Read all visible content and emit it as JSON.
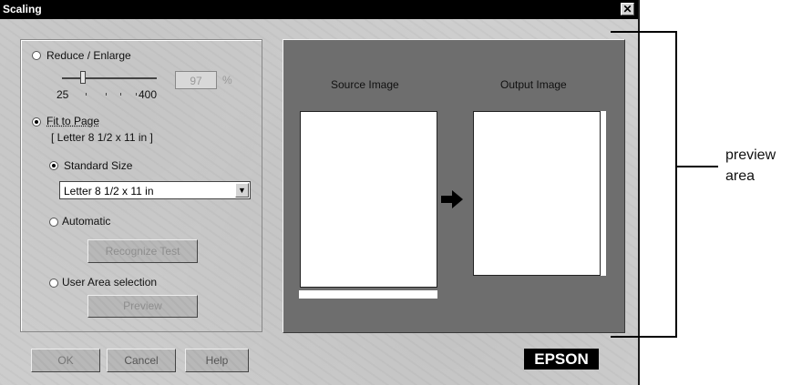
{
  "window": {
    "title": "Scaling",
    "close_label": "✕"
  },
  "scaling": {
    "reduce_enlarge_label": "Reduce / Enlarge",
    "slider_min": "25",
    "slider_max": "400",
    "percent_value": "97",
    "percent_unit": "%",
    "fit_to_page_label": "Fit to Page",
    "fit_to_page_detail": "[ Letter 8 1/2 x 11 in ]",
    "standard_size_label": "Standard Size",
    "standard_size_value": "Letter 8 1/2 x 11 in",
    "automatic_label": "Automatic",
    "recognize_test_label": "Recognize Test",
    "user_area_label": "User Area selection",
    "preview_button_label": "Preview"
  },
  "preview": {
    "source_label": "Source Image",
    "output_label": "Output Image"
  },
  "buttons": {
    "ok": "OK",
    "cancel": "Cancel",
    "help": "Help"
  },
  "brand": {
    "logo": "EPSON"
  },
  "annotation": {
    "line1": "preview",
    "line2": "area"
  },
  "state": {
    "selected_mode": "fit_to_page",
    "fit_option": "standard_size",
    "slider_fraction": 0.2
  },
  "colors": {
    "titlebar": "#000000",
    "preview_bg": "#6e6e6e",
    "dialog_bg": "#cfcfcf"
  },
  "icons": [
    "close-icon",
    "dropdown-arrow-icon",
    "right-arrow-icon"
  ]
}
